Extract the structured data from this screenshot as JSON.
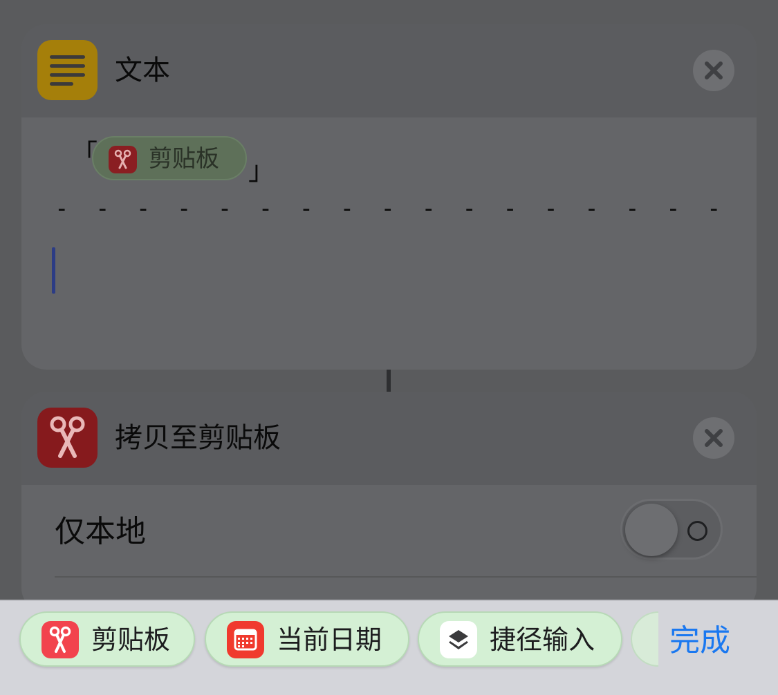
{
  "text_action": {
    "title": "文本",
    "icon": "text-lines-icon",
    "open_bracket": "「",
    "close_bracket": "」",
    "variable_label": "剪贴板",
    "dash_line": "- - - - - - - - - - - - - - - - -"
  },
  "copy_action": {
    "title": "拷贝至剪贴板",
    "icon": "scissors-icon",
    "option_label": "仅本地",
    "option_enabled": false
  },
  "suggestions": [
    {
      "label": "剪贴板",
      "icon": "scissors-icon",
      "icon_color": "#f2434d"
    },
    {
      "label": "当前日期",
      "icon": "calendar-icon",
      "icon_color": "#f03a2e"
    },
    {
      "label": "捷径输入",
      "icon": "shortcuts-icon",
      "icon_color": "#ffffff"
    }
  ],
  "done_label": "完成",
  "colors": {
    "accent": "#1a78f0",
    "chip_bg": "#d4f0d4"
  }
}
